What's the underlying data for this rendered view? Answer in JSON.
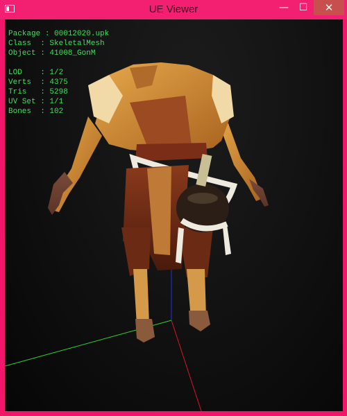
{
  "window": {
    "title": "UE Viewer",
    "buttons": {
      "minimize": "—",
      "maximize": "☐",
      "close": "✕"
    }
  },
  "info": {
    "rows_top": [
      {
        "label": "Package",
        "value": "00012020.upk"
      },
      {
        "label": "Class  ",
        "value": "SkeletalMesh"
      },
      {
        "label": "Object ",
        "value": "41008_GonM"
      }
    ],
    "rows_bottom": [
      {
        "label": "LOD    ",
        "value": "1/2"
      },
      {
        "label": "Verts  ",
        "value": "4375"
      },
      {
        "label": "Tris   ",
        "value": "5298"
      },
      {
        "label": "UV Set ",
        "value": "1/1"
      },
      {
        "label": "Bones  ",
        "value": "102"
      }
    ]
  },
  "colors": {
    "accent": "#f31f71",
    "overlay_text": "#3ee05a",
    "axis_x": "#e01030",
    "axis_y": "#2ad62a",
    "axis_z": "#2030e0"
  }
}
